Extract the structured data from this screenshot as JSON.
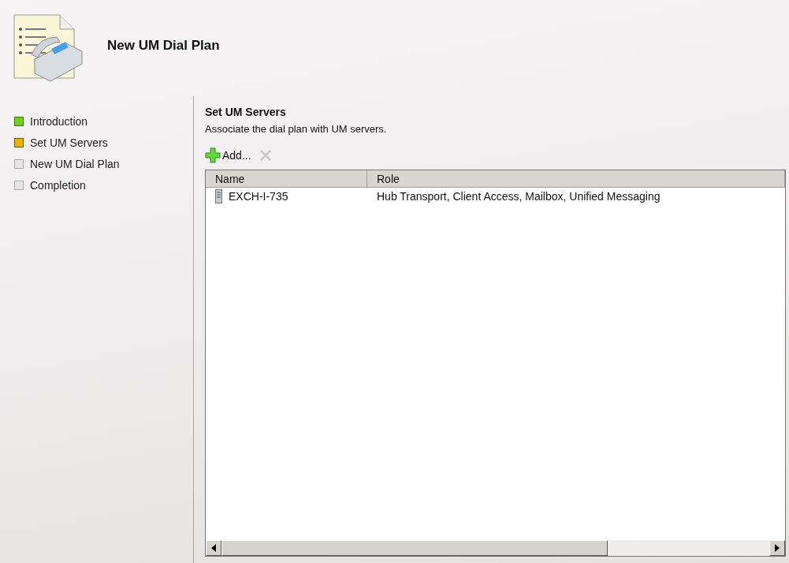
{
  "header": {
    "title": "New UM Dial Plan"
  },
  "steps": [
    {
      "label": "Introduction",
      "completed": true,
      "selected": false
    },
    {
      "label": "Set UM Servers",
      "completed": false,
      "selected": true
    },
    {
      "label": "New UM Dial Plan",
      "completed": false,
      "selected": false
    },
    {
      "label": "Completion",
      "completed": false,
      "selected": false
    }
  ],
  "section": {
    "title": "Set UM Servers",
    "description": "Associate the dial plan with UM servers."
  },
  "toolbar": {
    "add_label": "Add...",
    "remove_disabled": true
  },
  "table": {
    "columns": [
      "Name",
      "Role"
    ],
    "rows": [
      {
        "name": "EXCH-I-735",
        "role": "Hub Transport, Client Access, Mailbox, Unified Messaging"
      }
    ]
  }
}
